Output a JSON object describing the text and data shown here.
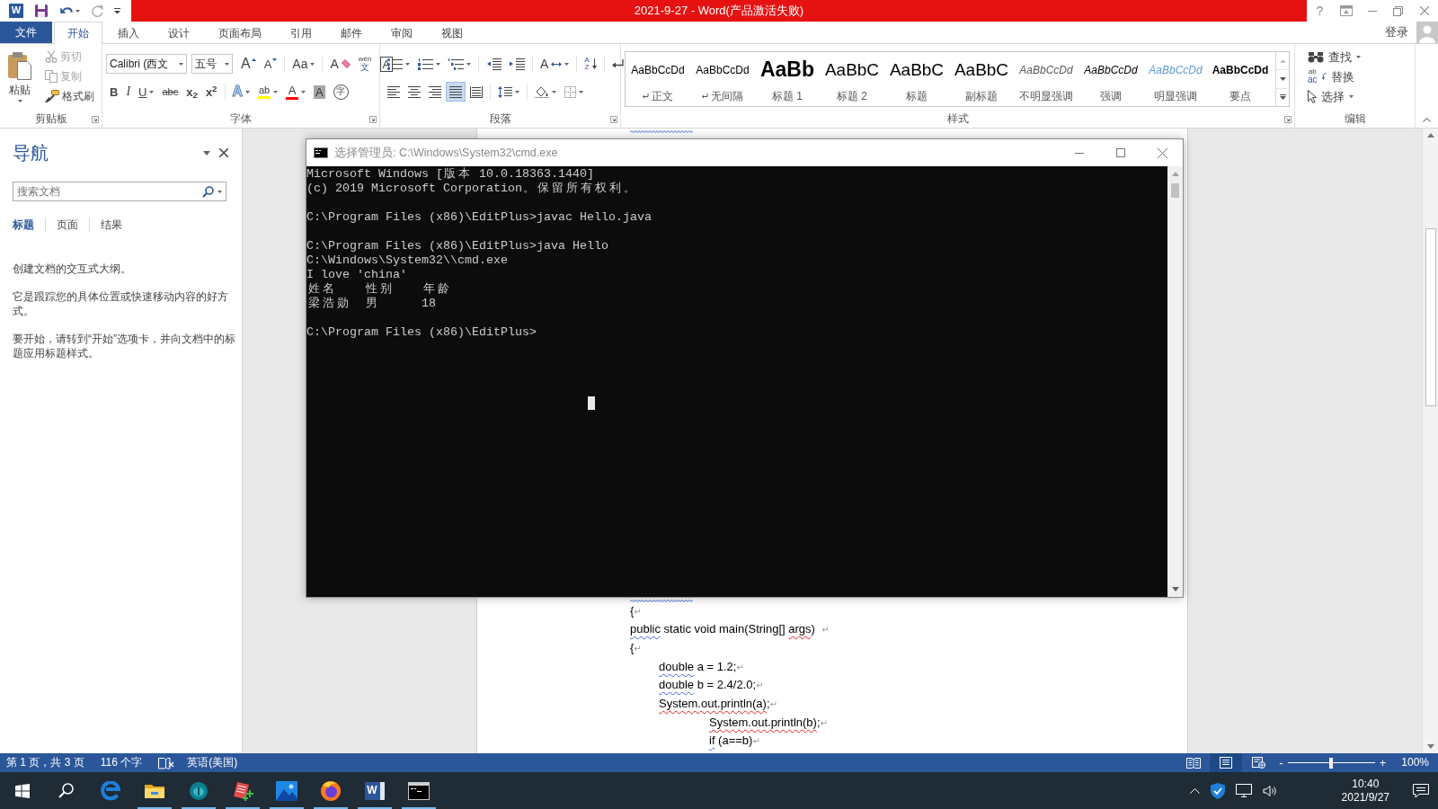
{
  "quick_access": [
    {
      "kind": "app_logo",
      "letter": "W"
    },
    {
      "kind": "save",
      "disabled": false
    },
    {
      "kind": "undo",
      "disabled": false,
      "dropdown": true
    },
    {
      "kind": "redo",
      "disabled": true,
      "dropdown": false
    },
    {
      "kind": "customize"
    }
  ],
  "title_bar": {
    "title": "2021-9-27 - Word(产品激活失败)",
    "controls": [
      {
        "kind": "help",
        "label": "?"
      },
      {
        "kind": "ribbon_display"
      },
      {
        "kind": "minimize"
      },
      {
        "kind": "restore"
      },
      {
        "kind": "close"
      }
    ]
  },
  "tabs": [
    {
      "kind": "file",
      "label": "文件",
      "selected": false
    },
    {
      "kind": "tab",
      "label": "开始",
      "selected": true
    },
    {
      "kind": "tab",
      "label": "插入",
      "selected": false
    },
    {
      "kind": "tab",
      "label": "设计",
      "selected": false
    },
    {
      "kind": "tab",
      "label": "页面布局",
      "selected": false
    },
    {
      "kind": "tab",
      "label": "引用",
      "selected": false
    },
    {
      "kind": "tab",
      "label": "邮件",
      "selected": false
    },
    {
      "kind": "tab",
      "label": "审阅",
      "selected": false
    },
    {
      "kind": "tab",
      "label": "视图",
      "selected": false
    }
  ],
  "account": {
    "label": "登录"
  },
  "ribbon": {
    "clipboard": {
      "label": "剪贴板",
      "launcher": true,
      "paste": {
        "label": "粘贴",
        "dropdown": true
      },
      "actions": [
        {
          "kind": "cut",
          "label": "剪切",
          "disabled": true
        },
        {
          "kind": "copy",
          "label": "复制",
          "disabled": true
        },
        {
          "kind": "format_painter",
          "label": "格式刷",
          "disabled": false
        }
      ]
    },
    "font": {
      "label": "字体",
      "launcher": true,
      "font_name": "Calibri (西文",
      "font_size": "五号",
      "row_1": [
        {
          "kind": "grow",
          "text": "A",
          "dropdown": false
        },
        {
          "kind": "shrink",
          "text": "A",
          "dropdown": false
        },
        {
          "kind": "separator"
        },
        {
          "kind": "case",
          "text": "Aa",
          "dropdown": true
        },
        {
          "kind": "separator"
        },
        {
          "kind": "clear",
          "text": "A",
          "dropdown": false
        },
        {
          "kind": "phonetic",
          "text": "wén",
          "sub_text": "文",
          "dropdown": false
        },
        {
          "kind": "border",
          "text": "A",
          "dropdown": false
        }
      ],
      "row_2": [
        {
          "kind": "bold",
          "text": "B",
          "dropdown": false
        },
        {
          "kind": "italic",
          "text": "I",
          "dropdown": false
        },
        {
          "kind": "underline",
          "text": "U",
          "dropdown": true
        },
        {
          "kind": "strike",
          "text": "abc",
          "dropdown": false
        },
        {
          "kind": "subscript",
          "text": "x$_{2}$",
          "dropdown": false
        },
        {
          "kind": "superscript",
          "text": "x$^{2}$",
          "dropdown": false
        },
        {
          "kind": "separator"
        },
        {
          "kind": "effects",
          "text": "A",
          "dropdown": true
        },
        {
          "kind": "highlight",
          "text": "ab",
          "color": "#ffff00",
          "dropdown": true
        },
        {
          "kind": "font_color",
          "text": "A",
          "color": "#ff0000",
          "dropdown": true
        },
        {
          "kind": "shading",
          "text": "A",
          "dropdown": false
        },
        {
          "kind": "enclose",
          "text": "字",
          "dropdown": false
        }
      ]
    },
    "paragraph": {
      "label": "段落",
      "launcher": true,
      "row_1": [
        {
          "kind": "bullets",
          "dropdown": true
        },
        {
          "kind": "numbering",
          "dropdown": true
        },
        {
          "kind": "multilevel",
          "dropdown": true
        },
        {
          "kind": "separator"
        },
        {
          "kind": "outdent",
          "dropdown": false
        },
        {
          "kind": "indent",
          "dropdown": false
        },
        {
          "kind": "separator"
        },
        {
          "kind": "asian_layout",
          "text": "A",
          "dropdown": true
        },
        {
          "kind": "separator"
        },
        {
          "kind": "sort",
          "text": "A",
          "sub_text": "Z",
          "dropdown": false
        },
        {
          "kind": "separator"
        },
        {
          "kind": "show_marks",
          "dropdown": false
        }
      ],
      "row_2": [
        {
          "kind": "align_left",
          "selected": false,
          "dropdown": false
        },
        {
          "kind": "align_center",
          "selected": false,
          "dropdown": false
        },
        {
          "kind": "align_right",
          "selected": false,
          "dropdown": false
        },
        {
          "kind": "justify",
          "selected": true,
          "dropdown": false
        },
        {
          "kind": "distribute",
          "selected": false,
          "dropdown": false
        },
        {
          "kind": "separator"
        },
        {
          "kind": "line_spacing",
          "dropdown": true
        },
        {
          "kind": "separator"
        },
        {
          "kind": "shading",
          "dropdown": true
        },
        {
          "kind": "borders",
          "dropdown": true
        }
      ]
    },
    "styles": {
      "label": "样式",
      "launcher": true,
      "items": [
        {
          "kind": "normal",
          "sample": "AaBbCcDd",
          "name": "正文",
          "para_mark": true
        },
        {
          "kind": "no_spacing",
          "sample": "AaBbCcDd",
          "name": "无间隔",
          "para_mark": true
        },
        {
          "kind": "heading_1",
          "sample": "AaBb",
          "name": "标题 1",
          "para_mark": false
        },
        {
          "kind": "heading_2",
          "sample": "AaBbC",
          "name": "标题 2",
          "para_mark": false
        },
        {
          "kind": "title",
          "sample": "AaBbC",
          "name": "标题",
          "para_mark": false
        },
        {
          "kind": "subtitle",
          "sample": "AaBbC",
          "name": "副标题",
          "para_mark": false
        },
        {
          "kind": "subtle_emphasis",
          "sample": "AaBbCcDd",
          "name": "不明显强调",
          "para_mark": false
        },
        {
          "kind": "emphasis",
          "sample": "AaBbCcDd",
          "name": "强调",
          "para_mark": false
        },
        {
          "kind": "intense_emphasis",
          "sample": "AaBbCcDd",
          "name": "明显强调",
          "para_mark": false
        },
        {
          "kind": "strong",
          "sample": "AaBbCcDd",
          "name": "要点",
          "para_mark": false
        }
      ]
    },
    "editing": {
      "label": "编辑",
      "launcher": false,
      "items": [
        {
          "kind": "find",
          "label": "查找",
          "dropdown": true
        },
        {
          "kind": "replace",
          "label": "替换",
          "icon_text": "ab",
          "icon_sub_text": "ac",
          "dropdown": false
        },
        {
          "kind": "select",
          "label": "选择",
          "dropdown": true
        }
      ]
    }
  },
  "navigation": {
    "title": "导航",
    "search": {
      "placeholder": "搜索文档"
    },
    "tabs": [
      {
        "label": "标题",
        "selected": true
      },
      {
        "label": "页面",
        "selected": false
      },
      {
        "label": "结果",
        "selected": false
      }
    ],
    "paragraphs": [
      "创建文档的交互式大纲。",
      "它是跟踪您的具体位置或快速移动内容的好方式。",
      "要开始，请转到“开始”选项卡，并向文档中的标题应用标题样式。"
    ]
  },
  "document": {
    "covered_lines": [
      {
        "kind": "grammar"
      },
      {
        "kind": "grammar"
      }
    ],
    "lines": [
      {
        "runs": [
          {
            "kind": "plain",
            "text": "{"
          }
        ],
        "end": "↵"
      },
      {
        "runs": [
          {
            "kind": "grammar",
            "text": "public"
          },
          {
            "kind": "plain",
            "text": " static void main(String[] "
          },
          {
            "kind": "spelling",
            "text": "args"
          },
          {
            "kind": "plain",
            "text": ")  "
          }
        ],
        "end": "↵"
      },
      {
        "runs": [
          {
            "kind": "plain",
            "text": "{"
          }
        ],
        "end": "↵",
        "children": [
          {
            "runs": [
              {
                "kind": "grammar",
                "text": "double"
              },
              {
                "kind": "plain",
                "text": " a = 1.2;"
              }
            ],
            "end": "↵"
          },
          {
            "runs": [
              {
                "kind": "grammar",
                "text": "double"
              },
              {
                "kind": "plain",
                "text": " b = 2.4/2.0;"
              }
            ],
            "end": "↵"
          },
          {
            "runs": [
              {
                "kind": "spelling",
                "text": "System.out.println(a)"
              },
              {
                "kind": "plain",
                "text": ";"
              }
            ],
            "end": "↵",
            "children": [
              {
                "runs": [
                  {
                    "kind": "spelling",
                    "text": "System.out.println(b)"
                  },
                  {
                    "kind": "plain",
                    "text": ";"
                  }
                ],
                "end": "↵"
              },
              {
                "runs": [
                  {
                    "kind": "grammar",
                    "text": "if"
                  },
                  {
                    "kind": "plain",
                    "text": " (a==b)"
                  }
                ],
                "end": "↵"
              }
            ]
          }
        ]
      }
    ]
  },
  "console": {
    "title": "选择管理员: C:\\Windows\\System32\\cmd.exe",
    "blocks": [
      [
        "Microsoft Windows [版本 10.0.18363.1440]",
        "(c) 2019 Microsoft Corporation。保留所有权利。"
      ],
      [
        "C:\\Program Files (x86)\\EditPlus>javac Hello.java"
      ],
      [
        "C:\\Program Files (x86)\\EditPlus>java Hello",
        "C:\\Windows\\System32\\\\cmd.exe",
        "I love 'china'",
        "姓名    性别    年龄",
        "梁浩勋  男      18"
      ],
      [
        "C:\\Program Files (x86)\\EditPlus>"
      ]
    ]
  },
  "status_bar": {
    "items": [
      {
        "kind": "page_count",
        "label": "第 1 页，共 3 页"
      },
      {
        "kind": "word_count",
        "label": "116 个字"
      },
      {
        "kind": "proofing"
      },
      {
        "kind": "language",
        "label": "英语(美国)"
      }
    ],
    "views": [
      {
        "kind": "read",
        "selected": false
      },
      {
        "kind": "print",
        "selected": true
      },
      {
        "kind": "web",
        "selected": false
      }
    ],
    "zoom": {
      "minus": "-",
      "plus": "+",
      "level": 0.5,
      "reading": "100%"
    }
  },
  "taskbar": {
    "apps": [
      {
        "kind": "start",
        "running": false
      },
      {
        "kind": "search",
        "running": false
      },
      {
        "kind": "edge",
        "running": false
      },
      {
        "kind": "explorer",
        "running": true
      },
      {
        "kind": "teal_app",
        "running": true
      },
      {
        "kind": "editplus",
        "running": true
      },
      {
        "kind": "photos",
        "running": true
      },
      {
        "kind": "firefox",
        "running": true
      },
      {
        "kind": "word",
        "letter": "W",
        "running": true
      },
      {
        "kind": "cmd",
        "running": true
      }
    ],
    "tray": [
      {
        "kind": "chevron"
      },
      {
        "kind": "shield"
      },
      {
        "kind": "network"
      },
      {
        "kind": "volume"
      }
    ],
    "clock": {
      "time": "10:40",
      "date": "2021/9/27"
    },
    "notification": true
  }
}
